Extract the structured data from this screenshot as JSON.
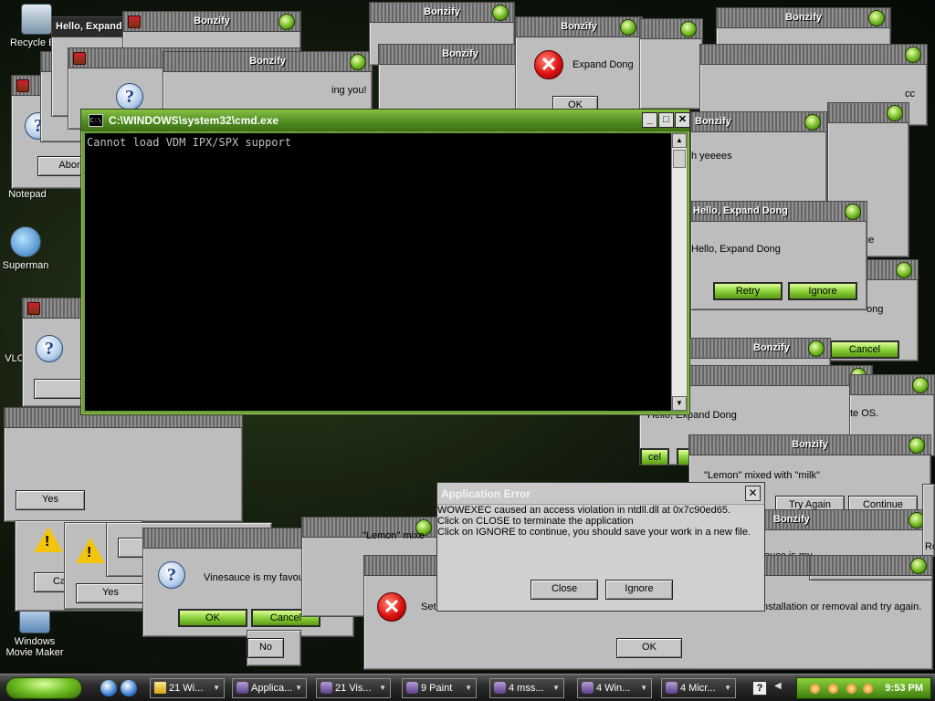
{
  "desktop": {
    "icons": [
      {
        "label": "Recycle Bin",
        "icon": "recycle-bin-icon"
      },
      {
        "label": "Notepad",
        "icon": "notepad-icon"
      },
      {
        "label": "Superman",
        "icon": "player-icon"
      },
      {
        "label": "VLC",
        "icon": "vlc-icon"
      },
      {
        "label": "Windows Movie Maker",
        "icon": "movie-maker-icon"
      }
    ]
  },
  "bonzify": {
    "title": "Bonzify",
    "hello_title": "Hello, Expand",
    "hello_dong_title": "Hello, Expand Dong",
    "msg_expand_dong": "Expand Dong",
    "msg_hello_expand_dong": "Hello, Expand Dong",
    "msg_yeeees": "h yeeees",
    "msg_ing_you": "ing you!",
    "msg_lemon_milk": "\"Lemon\" mixed with \"milk\"",
    "msg_lemon_short": "\"Lemon\" mixe",
    "msg_vinesauce": "Vinesauce is my favourite Anime",
    "msg_install": "nstallation or removal and try again.",
    "msg_set": "Set",
    "msg_os": "te OS.",
    "msg_ong": "ong",
    "msg_ue": "ue",
    "msg_cc": "cc",
    "msg_mv": "auce is my",
    "msg_re": "Re",
    "btn_ok": "OK",
    "btn_abort": "Abor",
    "btn_retry": "Retry",
    "btn_ignore": "Ignore",
    "btn_cancel": "Cancel",
    "btn_yes": "Yes",
    "btn_no": "No",
    "btn_try_again": "Try Again",
    "btn_continue": "Continue",
    "btn_ca": "Ca",
    "btn_cel": "cel"
  },
  "cmd": {
    "title": "C:\\WINDOWS\\system32\\cmd.exe",
    "icon_text": "C:\\",
    "output": "Cannot load VDM IPX/SPX support",
    "btn_minimize": "_",
    "btn_maximize": "□",
    "btn_close": "✕"
  },
  "app_error": {
    "title": "Application Error",
    "line1": "WOWEXEC caused an access violation in ntdll.dll at 0x7c90ed65.",
    "line2": "Click on CLOSE to terminate the application",
    "line3": "Click on IGNORE to continue, you should save your work in a new file.",
    "close_label": "Close",
    "ignore_label": "Ignore"
  },
  "taskbar": {
    "tasks": [
      {
        "label": "21 Wi...",
        "icon": "folder-icon"
      },
      {
        "label": "Applica...",
        "icon": "bonzi-icon"
      },
      {
        "label": "21 Vis...",
        "icon": "bonzi-icon"
      },
      {
        "label": "9 Paint",
        "icon": "bonzi-icon"
      },
      {
        "label": "4 mss...",
        "icon": "bonzi-icon"
      },
      {
        "label": "4 Win...",
        "icon": "bonzi-icon"
      },
      {
        "label": "4 Micr...",
        "icon": "bonzi-icon"
      }
    ],
    "help": "?",
    "clock": "9:53 PM"
  }
}
